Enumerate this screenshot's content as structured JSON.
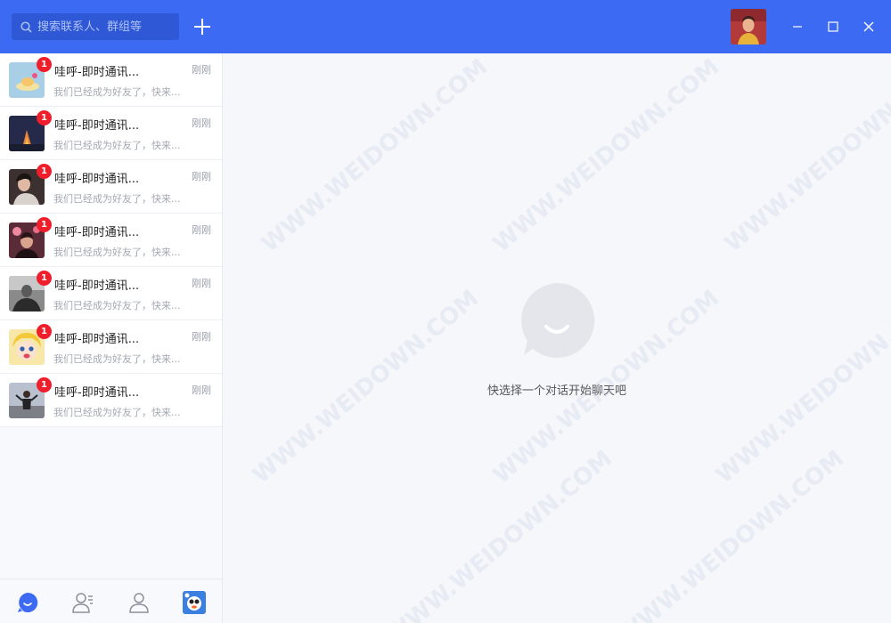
{
  "search": {
    "placeholder": "搜索联系人、群组等"
  },
  "colors": {
    "titlebar": "#3d6af2",
    "badge": "#f01d2b",
    "accent": "#3d6af2"
  },
  "icons": [
    "search-icon",
    "plus-icon",
    "minimize-icon",
    "maximize-icon",
    "close-icon",
    "chat-icon",
    "contacts-icon",
    "profile-icon",
    "app-icon"
  ],
  "chats": [
    {
      "name": "哇呼-即时通讯...",
      "time": "刚刚",
      "preview": "我们已经成为好友了，快来...",
      "unread": "1"
    },
    {
      "name": "哇呼-即时通讯...",
      "time": "刚刚",
      "preview": "我们已经成为好友了，快来...",
      "unread": "1"
    },
    {
      "name": "哇呼-即时通讯...",
      "time": "刚刚",
      "preview": "我们已经成为好友了，快来...",
      "unread": "1"
    },
    {
      "name": "哇呼-即时通讯...",
      "time": "刚刚",
      "preview": "我们已经成为好友了，快来...",
      "unread": "1"
    },
    {
      "name": "哇呼-即时通讯...",
      "time": "刚刚",
      "preview": "我们已经成为好友了，快来...",
      "unread": "1"
    },
    {
      "name": "哇呼-即时通讯...",
      "time": "刚刚",
      "preview": "我们已经成为好友了，快来...",
      "unread": "1"
    },
    {
      "name": "哇呼-即时通讯...",
      "time": "刚刚",
      "preview": "我们已经成为好友了，快来...",
      "unread": "1"
    }
  ],
  "main": {
    "empty_text": "快选择一个对话开始聊天吧"
  },
  "watermark": "WWW.WEIDOWN.COM"
}
